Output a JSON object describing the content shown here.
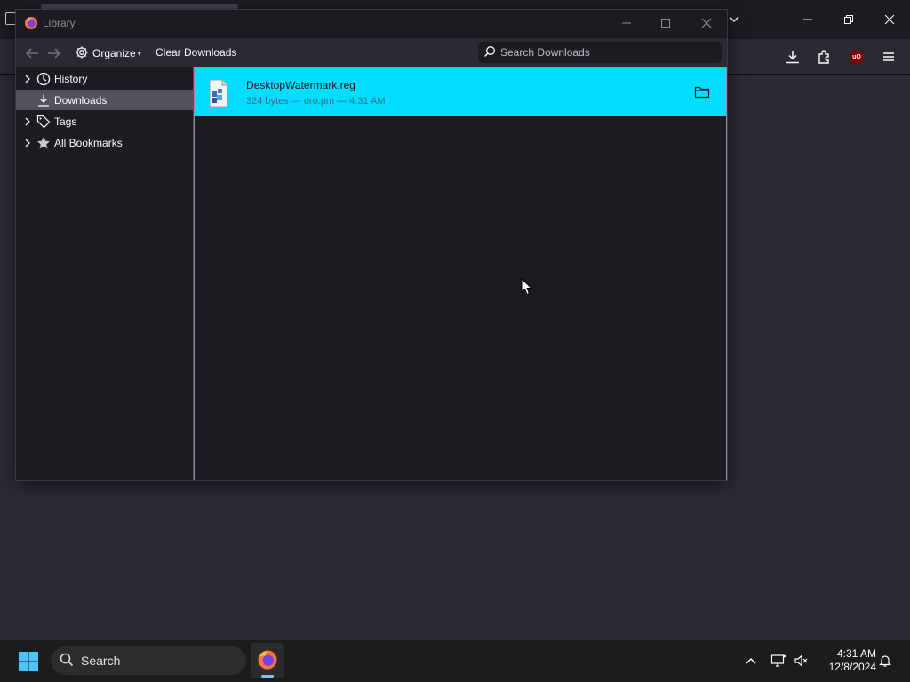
{
  "library": {
    "title": "Library",
    "toolbar": {
      "organize_label": "Organize",
      "clear_downloads_label": "Clear Downloads",
      "search_placeholder": "Search Downloads"
    },
    "sidebar": {
      "items": [
        {
          "label": "History",
          "icon": "clock-icon",
          "expandable": true,
          "selected": false
        },
        {
          "label": "Downloads",
          "icon": "download-icon",
          "expandable": false,
          "selected": true
        },
        {
          "label": "Tags",
          "icon": "tag-icon",
          "expandable": true,
          "selected": false
        },
        {
          "label": "All Bookmarks",
          "icon": "star-icon",
          "expandable": true,
          "selected": false
        }
      ]
    },
    "downloads": [
      {
        "filename": "DesktopWatermark.reg",
        "meta": "324 bytes — dro.pm — 4:31 AM",
        "icon": "reg-file-icon"
      }
    ]
  },
  "taskbar": {
    "search_label": "Search",
    "time": "4:31 AM",
    "date": "12/8/2024"
  },
  "colors": {
    "accent": "#00ddff",
    "selection": "#52525e",
    "background": "#1c1b22"
  }
}
